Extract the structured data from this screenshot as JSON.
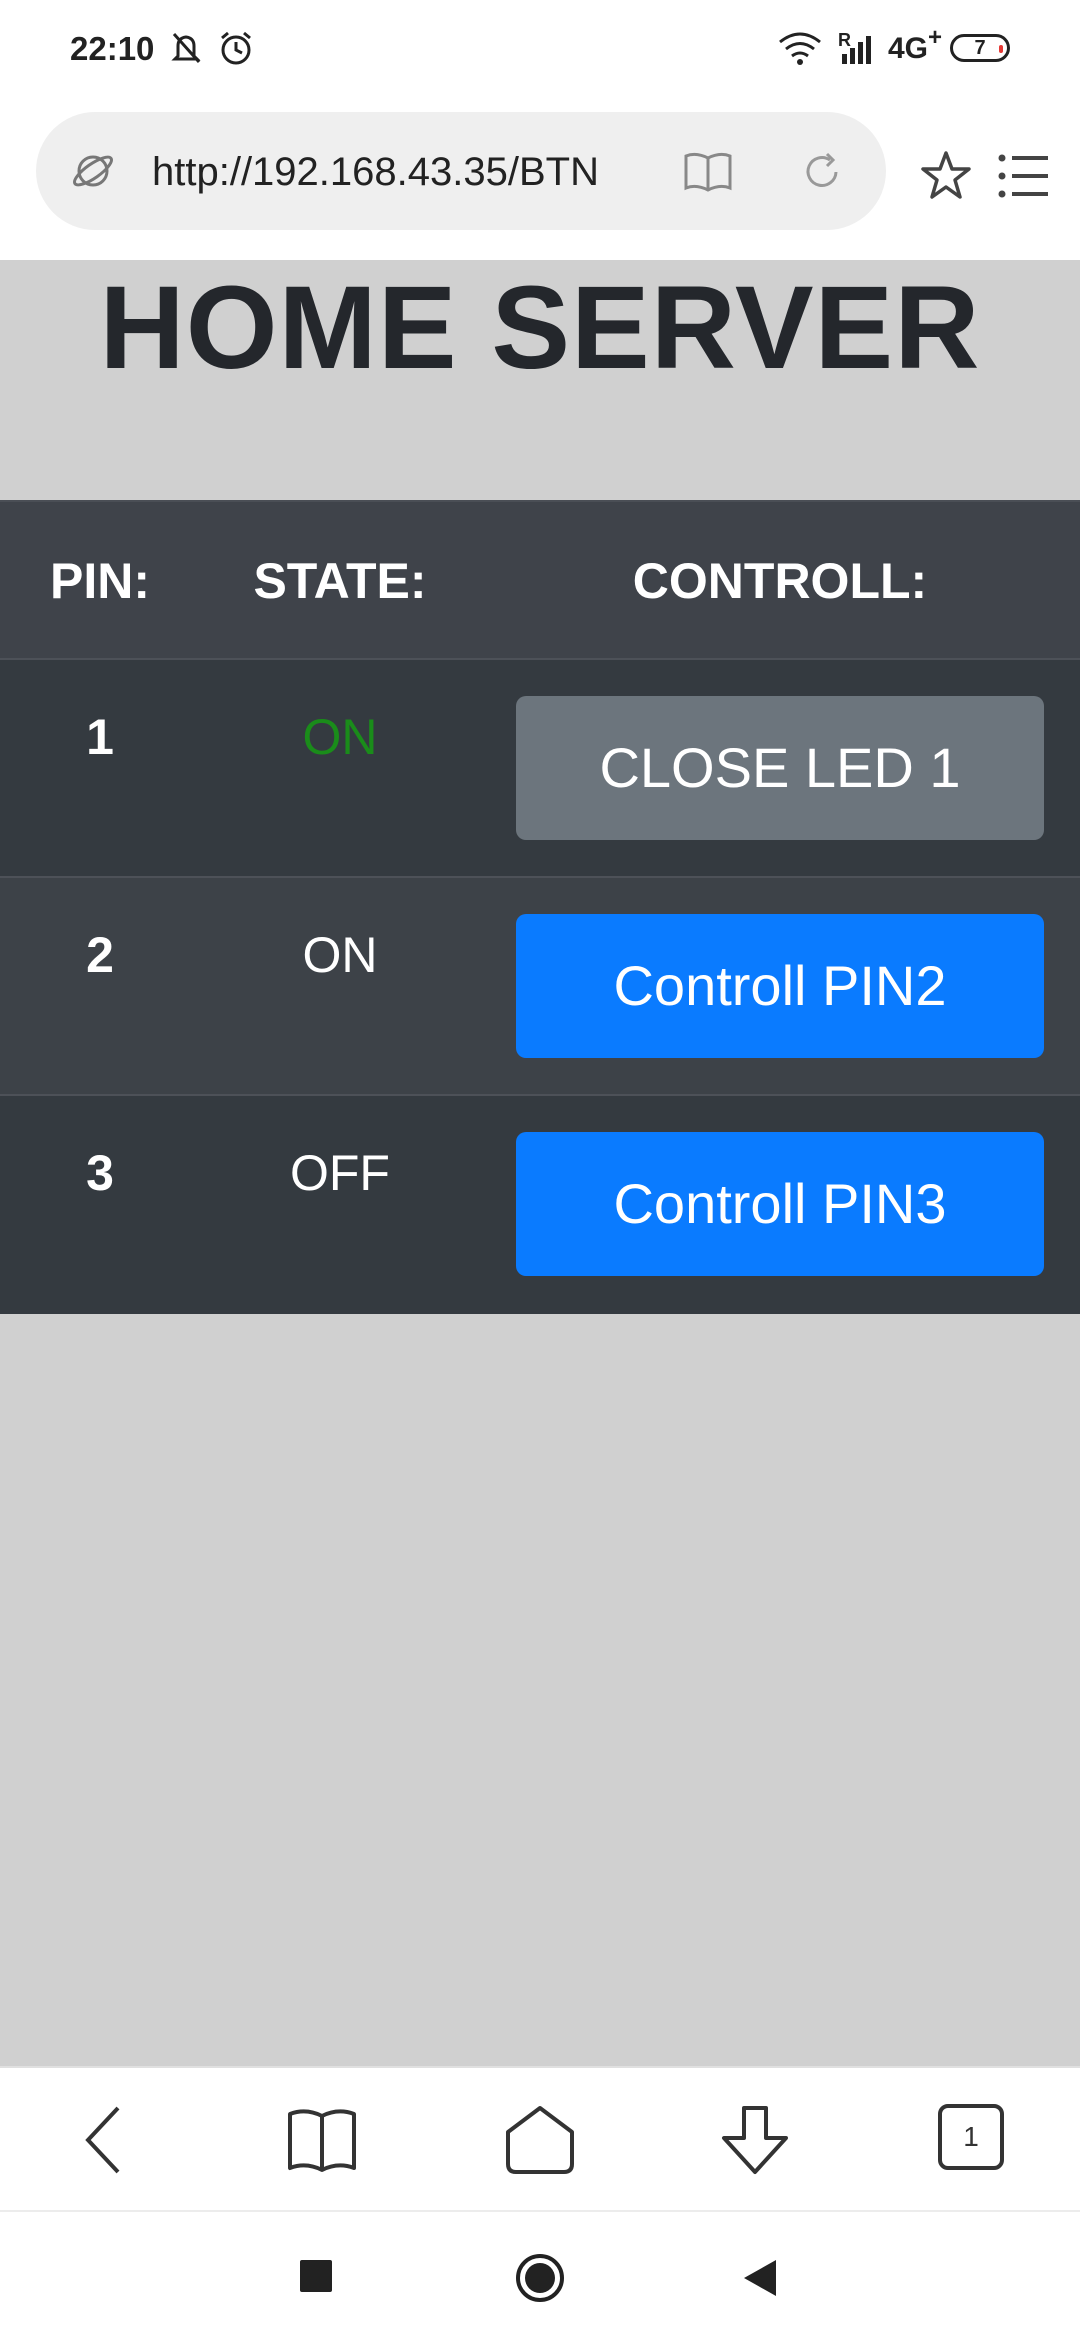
{
  "status_bar": {
    "time": "22:10",
    "network": "4G",
    "network_plus": "+",
    "roaming": "R",
    "battery": "7",
    "icons": [
      "mute-icon",
      "alarm-icon",
      "wifi-icon",
      "signal-icon",
      "battery-icon"
    ]
  },
  "browser": {
    "url": "http://192.168.43.35/BTN",
    "icons": [
      "globe-icon",
      "reader-icon",
      "reload-icon",
      "star-icon",
      "menu-icon"
    ]
  },
  "page": {
    "title": "HOME SERVER",
    "table": {
      "headers": [
        "PIN:",
        "STATE:",
        "CONTROLL:"
      ],
      "rows": [
        {
          "pin": "1",
          "state": "ON",
          "state_color": "#1a8c1a",
          "button": "CLOSE LED 1",
          "button_style": "secondary"
        },
        {
          "pin": "2",
          "state": "ON",
          "state_color": "#ffffff",
          "button": "Controll PIN2",
          "button_style": "primary"
        },
        {
          "pin": "3",
          "state": "OFF",
          "state_color": "#ffffff",
          "button": "Controll PIN3",
          "button_style": "primary"
        }
      ]
    }
  },
  "bottom_nav": {
    "tab_count": "1",
    "icons": [
      "back-icon",
      "bookmarks-icon",
      "home-icon",
      "download-icon",
      "tabs-icon"
    ]
  },
  "system_nav": {
    "icons": [
      "recents-icon",
      "home-circle-icon",
      "back-triangle-icon"
    ]
  },
  "colors": {
    "primary": "#0a7bff",
    "secondary": "#6c757d",
    "table_dark": "#343a40",
    "table_light": "#3d4248",
    "page_bg": "#d0d0d0",
    "state_on_green": "#1a8c1a"
  }
}
